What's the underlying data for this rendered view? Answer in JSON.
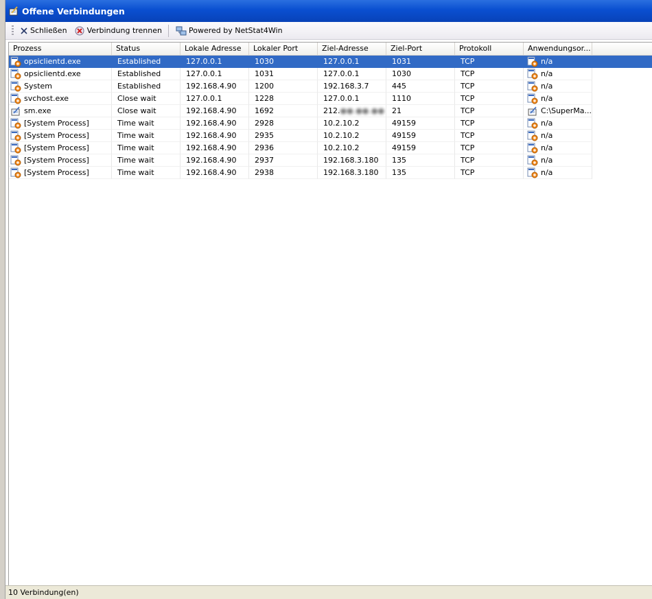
{
  "window": {
    "title": "Offene Verbindungen",
    "title_icon": "notepad-icon"
  },
  "toolbar": {
    "close_label": "Schließen",
    "disconnect_label": "Verbindung trennen",
    "powered_label": "Powered by NetStat4Win"
  },
  "columns": [
    "Prozess",
    "Status",
    "Lokale Adresse",
    "Lokaler Port",
    "Ziel-Adresse",
    "Ziel-Port",
    "Protokoll",
    "Anwendungsor..."
  ],
  "rows": [
    {
      "process": "opsiclientd.exe",
      "status": "Established",
      "local_addr": "127.0.0.1",
      "local_port": "1030",
      "remote_addr": "127.0.0.1",
      "remote_addr_tail": "",
      "remote_port": "1031",
      "protocol": "TCP",
      "app": "n/a",
      "icon": "process-icon",
      "selected": true
    },
    {
      "process": "opsiclientd.exe",
      "status": "Established",
      "local_addr": "127.0.0.1",
      "local_port": "1031",
      "remote_addr": "127.0.0.1",
      "remote_addr_tail": "",
      "remote_port": "1030",
      "protocol": "TCP",
      "app": "n/a",
      "icon": "process-icon"
    },
    {
      "process": "System",
      "status": "Established",
      "local_addr": "192.168.4.90",
      "local_port": "1200",
      "remote_addr": "192.168.3.7",
      "remote_addr_tail": "",
      "remote_port": "445",
      "protocol": "TCP",
      "app": "n/a",
      "icon": "process-icon"
    },
    {
      "process": "svchost.exe",
      "status": "Close wait",
      "local_addr": "127.0.0.1",
      "local_port": "1228",
      "remote_addr": "127.0.0.1",
      "remote_addr_tail": "",
      "remote_port": "1110",
      "protocol": "TCP",
      "app": "n/a",
      "icon": "process-icon"
    },
    {
      "process": "sm.exe",
      "status": "Close wait",
      "local_addr": "192.168.4.90",
      "local_port": "1692",
      "remote_addr": "212.",
      "remote_addr_tail": "",
      "remote_port": "21",
      "protocol": "TCP",
      "app": "C:\\SuperMa...",
      "icon": "notepad-icon",
      "redacted": true
    },
    {
      "process": "[System Process]",
      "status": "Time wait",
      "local_addr": "192.168.4.90",
      "local_port": "2928",
      "remote_addr": "10.2.10.2",
      "remote_addr_tail": "",
      "remote_port": "49159",
      "protocol": "TCP",
      "app": "n/a",
      "icon": "process-icon"
    },
    {
      "process": "[System Process]",
      "status": "Time wait",
      "local_addr": "192.168.4.90",
      "local_port": "2935",
      "remote_addr": "10.2.10.2",
      "remote_addr_tail": "",
      "remote_port": "49159",
      "protocol": "TCP",
      "app": "n/a",
      "icon": "process-icon"
    },
    {
      "process": "[System Process]",
      "status": "Time wait",
      "local_addr": "192.168.4.90",
      "local_port": "2936",
      "remote_addr": "10.2.10.2",
      "remote_addr_tail": "",
      "remote_port": "49159",
      "protocol": "TCP",
      "app": "n/a",
      "icon": "process-icon"
    },
    {
      "process": "[System Process]",
      "status": "Time wait",
      "local_addr": "192.168.4.90",
      "local_port": "2937",
      "remote_addr": "192.168.3.180",
      "remote_addr_tail": "",
      "remote_port": "135",
      "protocol": "TCP",
      "app": "n/a",
      "icon": "process-icon"
    },
    {
      "process": "[System Process]",
      "status": "Time wait",
      "local_addr": "192.168.4.90",
      "local_port": "2938",
      "remote_addr": "192.168.3.180",
      "remote_addr_tail": "",
      "remote_port": "135",
      "protocol": "TCP",
      "app": "n/a",
      "icon": "process-icon"
    }
  ],
  "statusbar": {
    "text": "10 Verbindung(en)"
  },
  "colors": {
    "title_blue": "#0a4fd0",
    "selection": "#316ac5",
    "statusbar_bg": "#ece9d8"
  }
}
